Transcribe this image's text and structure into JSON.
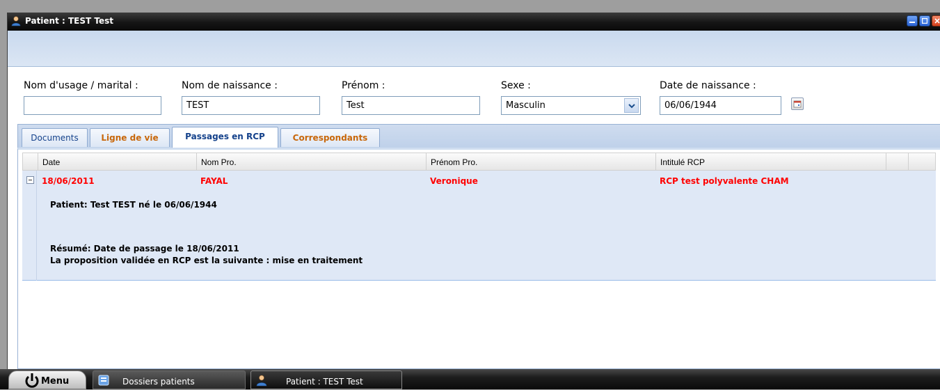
{
  "window": {
    "title": "Patient : TEST Test"
  },
  "form": {
    "nom_usage": {
      "label": "Nom d'usage / marital :",
      "value": ""
    },
    "nom_naissance": {
      "label": "Nom de naissance :",
      "value": "TEST"
    },
    "prenom": {
      "label": "Prénom :",
      "value": "Test"
    },
    "sexe": {
      "label": "Sexe :",
      "value": "Masculin"
    },
    "date_naissance": {
      "label": "Date de naissance :",
      "value": "06/06/1944"
    }
  },
  "tabs": [
    {
      "label": "Documents",
      "active": false
    },
    {
      "label": "Ligne de vie",
      "active": false
    },
    {
      "label": "Passages en RCP",
      "active": true
    },
    {
      "label": "Correspondants",
      "active": false
    }
  ],
  "grid": {
    "columns": [
      "Date",
      "Nom Pro.",
      "Prénom Pro.",
      "Intitulé RCP"
    ],
    "rows": [
      {
        "date": "18/06/2011",
        "nom_pro": "FAYAL",
        "prenom_pro": "Veronique",
        "intitule": "RCP test polyvalente CHAM",
        "details": {
          "patient": "Patient: Test TEST né le 06/06/1944",
          "resume": "Résumé: Date de passage le 18/06/2011",
          "proposition": "La proposition validée en RCP est la suivante : mise en traitement"
        }
      }
    ]
  },
  "taskbar": {
    "menu_label": "Menu",
    "items": [
      {
        "label": "Dossiers patients",
        "active": false
      },
      {
        "label": "Patient : TEST Test",
        "active": true
      }
    ]
  },
  "colors": {
    "row_highlight": "#dfe8f6",
    "row_text_red": "#ff0000",
    "tab_orange": "#c8670a",
    "tab_blue": "#15428b"
  }
}
